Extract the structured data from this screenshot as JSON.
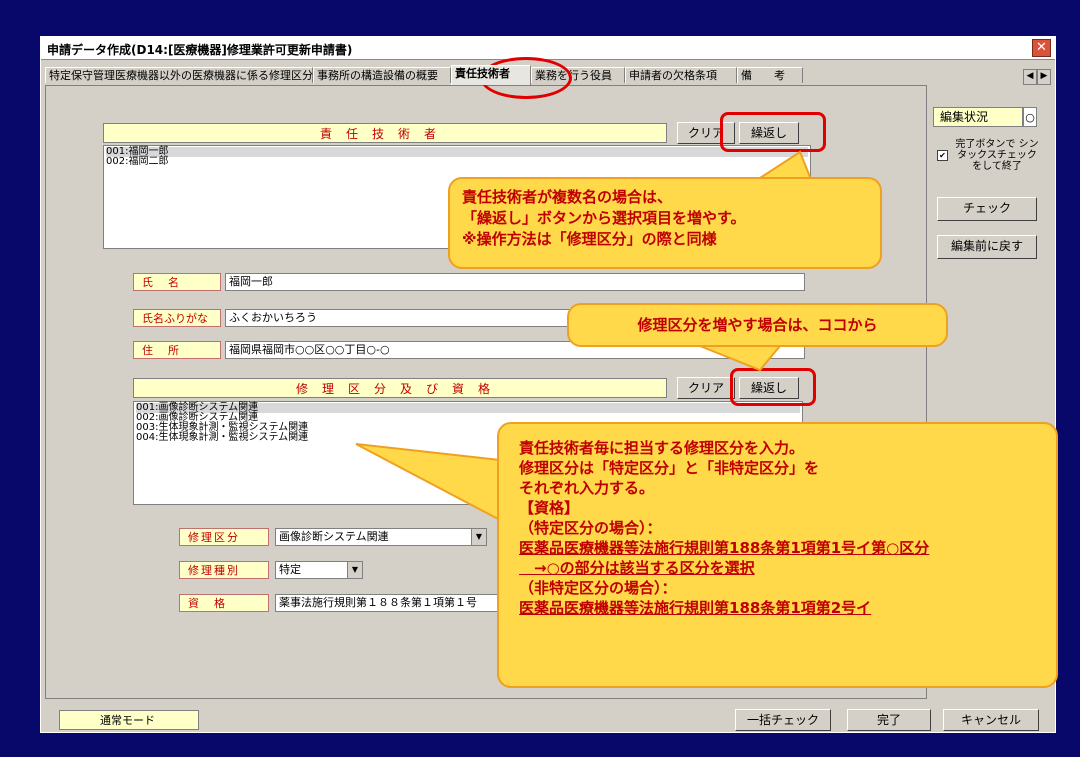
{
  "window": {
    "title": "申請データ作成(D14:[医療機器]修理業許可更新申請書)",
    "close_label": "✕"
  },
  "tabs": [
    {
      "label": "特定保守管理医療機器以外の医療機器に係る修理区分"
    },
    {
      "label": "事務所の構造設備の概要"
    },
    {
      "label": "責任技術者"
    },
    {
      "label": "業務を行う役員"
    },
    {
      "label": "申請者の欠格条項"
    },
    {
      "label": "備　　考"
    }
  ],
  "tab_scroll": {
    "left": "◀",
    "right": "▶"
  },
  "section1": {
    "header": "責任技術者",
    "clear_label": "クリア",
    "repeat_label": "繰返し",
    "items": [
      "001:福岡一郎",
      "002:福岡二郎"
    ]
  },
  "fields": {
    "name_label": "氏　名",
    "name_value": "福岡一郎",
    "furigana_label": "氏名ふりがな",
    "furigana_value": "ふくおかいちろう",
    "address_label": "住　所",
    "address_value": "福岡県福岡市○○区○○丁目○-○"
  },
  "section2": {
    "header": "修理区分及び資格",
    "clear_label": "クリア",
    "repeat_label": "繰返し",
    "items": [
      "001:画像診断システム関連",
      "002:画像診断システム関連",
      "003:生体現象計測・監視システム関連",
      "004:生体現象計測・監視システム関連"
    ]
  },
  "fields2": {
    "repair_cat_label": "修理区分",
    "repair_cat_value": "画像診断システム関連",
    "repair_type_label": "修理種別",
    "repair_type_value": "特定",
    "qual_label": "資　格",
    "qual_value": "薬事法施行規則第１８８条第１項第１号"
  },
  "side": {
    "edit_status_label": "編集状況",
    "edit_status_value": "○",
    "checkbox_text": "完了ボタンで シンタックスチェック をして終了",
    "checkbox_mark": "✔",
    "check_label": "チェック",
    "revert_label": "編集前に戻す"
  },
  "footer": {
    "mode": "通常モード",
    "bulk_check": "一括チェック",
    "done": "完了",
    "cancel": "キャンセル"
  },
  "callouts": {
    "c1": [
      "責任技術者が複数名の場合は、",
      "「繰返し」ボタンから選択項目を増やす。",
      "※操作方法は「修理区分」の際と同様"
    ],
    "c2": "修理区分を増やす場合は、ココから",
    "c3": [
      "責任技術者毎に担当する修理区分を入力。",
      "修理区分は「特定区分」と「非特定区分」を",
      "それぞれ入力する。",
      "【資格】",
      "（特定区分の場合）：",
      "医薬品医療機器等法施行規則第188条第1項第1号イ第○区分",
      "　→○の部分は該当する区分を選択",
      "（非特定区分の場合）：",
      "医薬品医療機器等法施行規則第188条第1項第2号イ"
    ]
  },
  "colors": {
    "background": "#08086a",
    "callout": "#ffd94a",
    "highlight": "#e00000",
    "label_text": "#c00000"
  }
}
